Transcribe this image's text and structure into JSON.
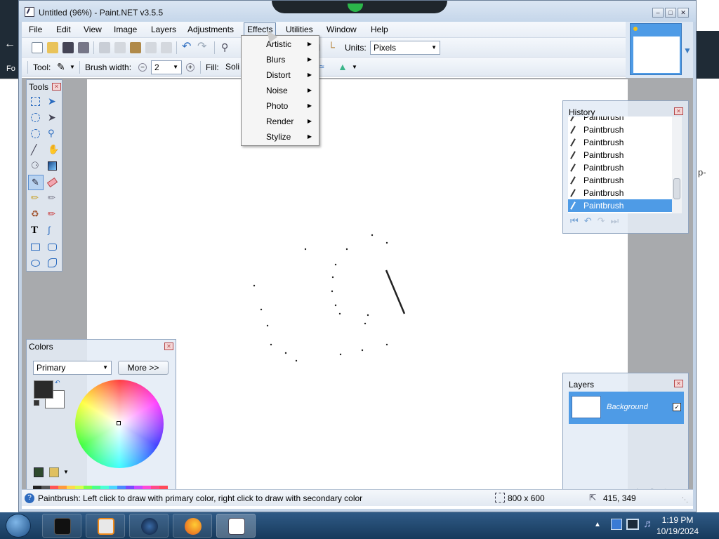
{
  "window": {
    "title": "Untitled (96%) - Paint.NET v3.5.5"
  },
  "menubar": [
    "File",
    "Edit",
    "View",
    "Image",
    "Layers",
    "Adjustments",
    "Effects",
    "Utilities",
    "Window",
    "Help"
  ],
  "toolbar": {
    "units_label": "Units:",
    "units_value": "Pixels",
    "tool_label": "Tool:",
    "brush_width_label": "Brush width:",
    "brush_width_value": "2",
    "fill_label": "Fill:",
    "fill_value": "Soli"
  },
  "effects_menu": [
    "Artistic",
    "Blurs",
    "Distort",
    "Noise",
    "Photo",
    "Render",
    "Stylize"
  ],
  "tools_panel": {
    "title": "Tools"
  },
  "history_panel": {
    "title": "History",
    "items": [
      "Paintbrush",
      "Paintbrush",
      "Paintbrush",
      "Paintbrush",
      "Paintbrush",
      "Paintbrush",
      "Paintbrush",
      "Paintbrush"
    ],
    "selected_index": 7
  },
  "colors_panel": {
    "title": "Colors",
    "mode": "Primary",
    "more_button": "More >>",
    "primary_color": "#2a2a2a",
    "secondary_color": "#ffffff",
    "palette": [
      "#222222",
      "#555555",
      "#ff5555",
      "#ff9a3c",
      "#ffd84a",
      "#d6ff4a",
      "#7cff4a",
      "#4aff8a",
      "#4affd6",
      "#4ad6ff",
      "#4a8aff",
      "#7a4aff",
      "#c84aff",
      "#ff4ad6",
      "#ff4a8a",
      "#ff4a5a",
      "#808080",
      "#aaaaaa",
      "#c83232",
      "#c8742a",
      "#c8a832",
      "#a8c832",
      "#58c832",
      "#32c86a",
      "#32c8a8",
      "#32a8c8",
      "#326ac8",
      "#5a32c8",
      "#9a32c8",
      "#c832a8",
      "#c8326a",
      "#c83244"
    ]
  },
  "layers_panel": {
    "title": "Layers",
    "items": [
      {
        "name": "Background",
        "visible": true
      }
    ]
  },
  "statusbar": {
    "help": "Paintbrush: Left click to draw with primary color, right click to draw with secondary color",
    "image_size": "800 x 600",
    "cursor_pos": "415, 349"
  },
  "taskbar": {
    "time": "1:19 PM",
    "date": "10/19/2024"
  },
  "background": {
    "left_text": "Fo",
    "right_text": "p-"
  }
}
